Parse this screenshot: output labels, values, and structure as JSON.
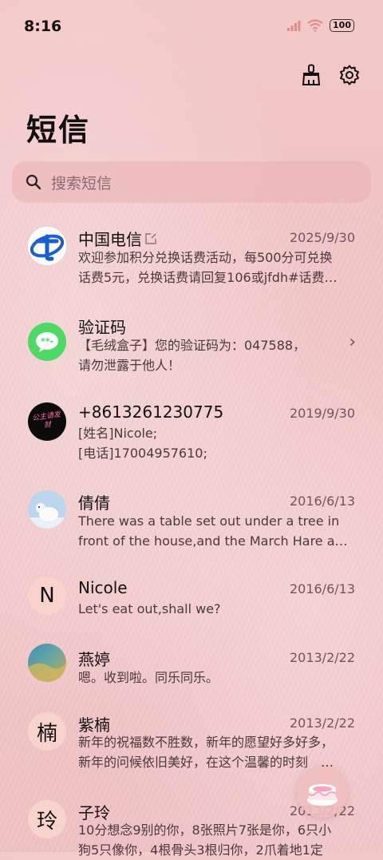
{
  "status": {
    "time": "8:16",
    "battery": "100"
  },
  "header": {
    "title": "短信"
  },
  "search": {
    "placeholder": "搜索短信"
  },
  "messages": [
    {
      "name": "中国电信",
      "date": "2025/9/30",
      "line1": "欢迎参加积分兑换话费活动，每500分可兑换",
      "line2": "话费5元，兑换话费请回复106或jfdh#话费…"
    },
    {
      "name": "验证码",
      "date": "",
      "line1": "【毛绒盒子】您的验证码为：047588，",
      "line2": "请勿泄露于他人！"
    },
    {
      "name": "+8613261230775",
      "date": "2019/9/30",
      "line1": "[姓名]Nicole;",
      "line2": "[电话]17004957610;",
      "avatar_text": "公主请发财"
    },
    {
      "name": "倩倩",
      "date": "2016/6/13",
      "line1": "There was a table set out under a tree in",
      "line2": "front of the house,and the March Hare an…"
    },
    {
      "name": "Nicole",
      "date": "2016/6/13",
      "line1": "Let's eat out,shall we?",
      "line2": "",
      "avatar_letter": "N"
    },
    {
      "name": "燕婷",
      "date": "2013/2/22",
      "line1": "嗯。收到啦。同乐同乐。",
      "line2": ""
    },
    {
      "name": "紫楠",
      "date": "2013/2/22",
      "line1": "新年的祝福数不胜数，新年的愿望好多好多，",
      "line2": "新年的问候依旧美好，在这个温馨的时刻　…",
      "avatar_letter": "楠"
    },
    {
      "name": "子玲",
      "date": "2013/2/22",
      "line1": "10分想念9别的你，8张照片7张是你，6只小",
      "line2": "狗5只像你，4根骨头3根归你，2爪着地1定",
      "avatar_letter": "玲"
    }
  ],
  "icons": {
    "clean": "broom-icon",
    "settings": "gear-icon",
    "search": "search-icon",
    "chevron": "chevron-right-icon",
    "external": "external-link-icon",
    "fab": "cake-icon"
  },
  "colors": {
    "background": "#f0c4c5",
    "search_bg": "#eab0b4",
    "letter_avatar": "#f8d3cd",
    "telecom_blue": "#1a5fd1",
    "sms_green": "#4cd964"
  }
}
